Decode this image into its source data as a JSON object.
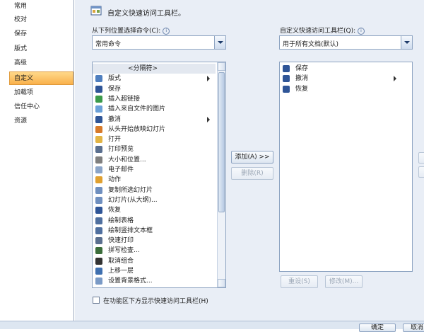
{
  "nav": {
    "items": [
      {
        "label": "常用",
        "selected": false
      },
      {
        "label": "校对",
        "selected": false
      },
      {
        "label": "保存",
        "selected": false
      },
      {
        "label": "版式",
        "selected": false
      },
      {
        "label": "高级",
        "selected": false
      },
      {
        "label": "自定义",
        "selected": true
      },
      {
        "label": "加载项",
        "selected": false
      },
      {
        "label": "信任中心",
        "selected": false
      },
      {
        "label": "资源",
        "selected": false
      }
    ]
  },
  "header": {
    "title": "自定义快速访问工具栏。"
  },
  "left_panel": {
    "label": "从下列位置选择命令(C):",
    "combo_value": "常用命令",
    "commands": [
      {
        "label": "<分隔符>",
        "icon": "separator",
        "submenu": false
      },
      {
        "label": "版式",
        "icon": "layout-icon",
        "submenu": true
      },
      {
        "label": "保存",
        "icon": "save-icon",
        "submenu": false
      },
      {
        "label": "插入超链接",
        "icon": "hyperlink-icon",
        "submenu": false
      },
      {
        "label": "插入来自文件的图片",
        "icon": "picture-icon",
        "submenu": false
      },
      {
        "label": "撤消",
        "icon": "undo-icon",
        "submenu": true
      },
      {
        "label": "从头开始放映幻灯片",
        "icon": "slideshow-icon",
        "submenu": false
      },
      {
        "label": "打开",
        "icon": "open-folder-icon",
        "submenu": false
      },
      {
        "label": "打印预览",
        "icon": "print-preview-icon",
        "submenu": false
      },
      {
        "label": "大小和位置...",
        "icon": "size-position-icon",
        "submenu": false
      },
      {
        "label": "电子邮件",
        "icon": "email-icon",
        "submenu": false
      },
      {
        "label": "动作",
        "icon": "action-icon",
        "submenu": false
      },
      {
        "label": "复制所选幻灯片",
        "icon": "duplicate-slide-icon",
        "submenu": false
      },
      {
        "label": "幻灯片(从大纲)...",
        "icon": "slide-outline-icon",
        "submenu": false
      },
      {
        "label": "恢复",
        "icon": "redo-icon",
        "submenu": false
      },
      {
        "label": "绘制表格",
        "icon": "draw-table-icon",
        "submenu": false
      },
      {
        "label": "绘制竖排文本框",
        "icon": "vertical-textbox-icon",
        "submenu": false
      },
      {
        "label": "快速打印",
        "icon": "quick-print-icon",
        "submenu": false
      },
      {
        "label": "拼写检查...",
        "icon": "spelling-icon",
        "submenu": false
      },
      {
        "label": "取消组合",
        "icon": "ungroup-icon",
        "submenu": false
      },
      {
        "label": "上移一层",
        "icon": "bring-forward-icon",
        "submenu": false
      },
      {
        "label": "设置背景格式...",
        "icon": "background-format-icon",
        "submenu": false
      }
    ]
  },
  "right_panel": {
    "label": "自定义快速访问工具栏(Q):",
    "combo_value": "用于所有文档(默认)",
    "items": [
      {
        "label": "保存",
        "icon": "save-icon",
        "submenu": false
      },
      {
        "label": "撤消",
        "icon": "undo-icon",
        "submenu": true
      },
      {
        "label": "恢复",
        "icon": "redo-icon",
        "submenu": false
      }
    ],
    "reset_label": "重设(S)",
    "modify_label": "修改(M)..."
  },
  "buttons": {
    "add": "添加(A) >>",
    "remove": "删除(R)",
    "ok": "确定",
    "cancel": "取消"
  },
  "checkbox": {
    "label": "在功能区下方显示快速访问工具栏(H)",
    "checked": false
  },
  "colors": {
    "selection": "#f9b14c",
    "panel_bg": "#e9eef6",
    "border": "#8ea4c2"
  }
}
